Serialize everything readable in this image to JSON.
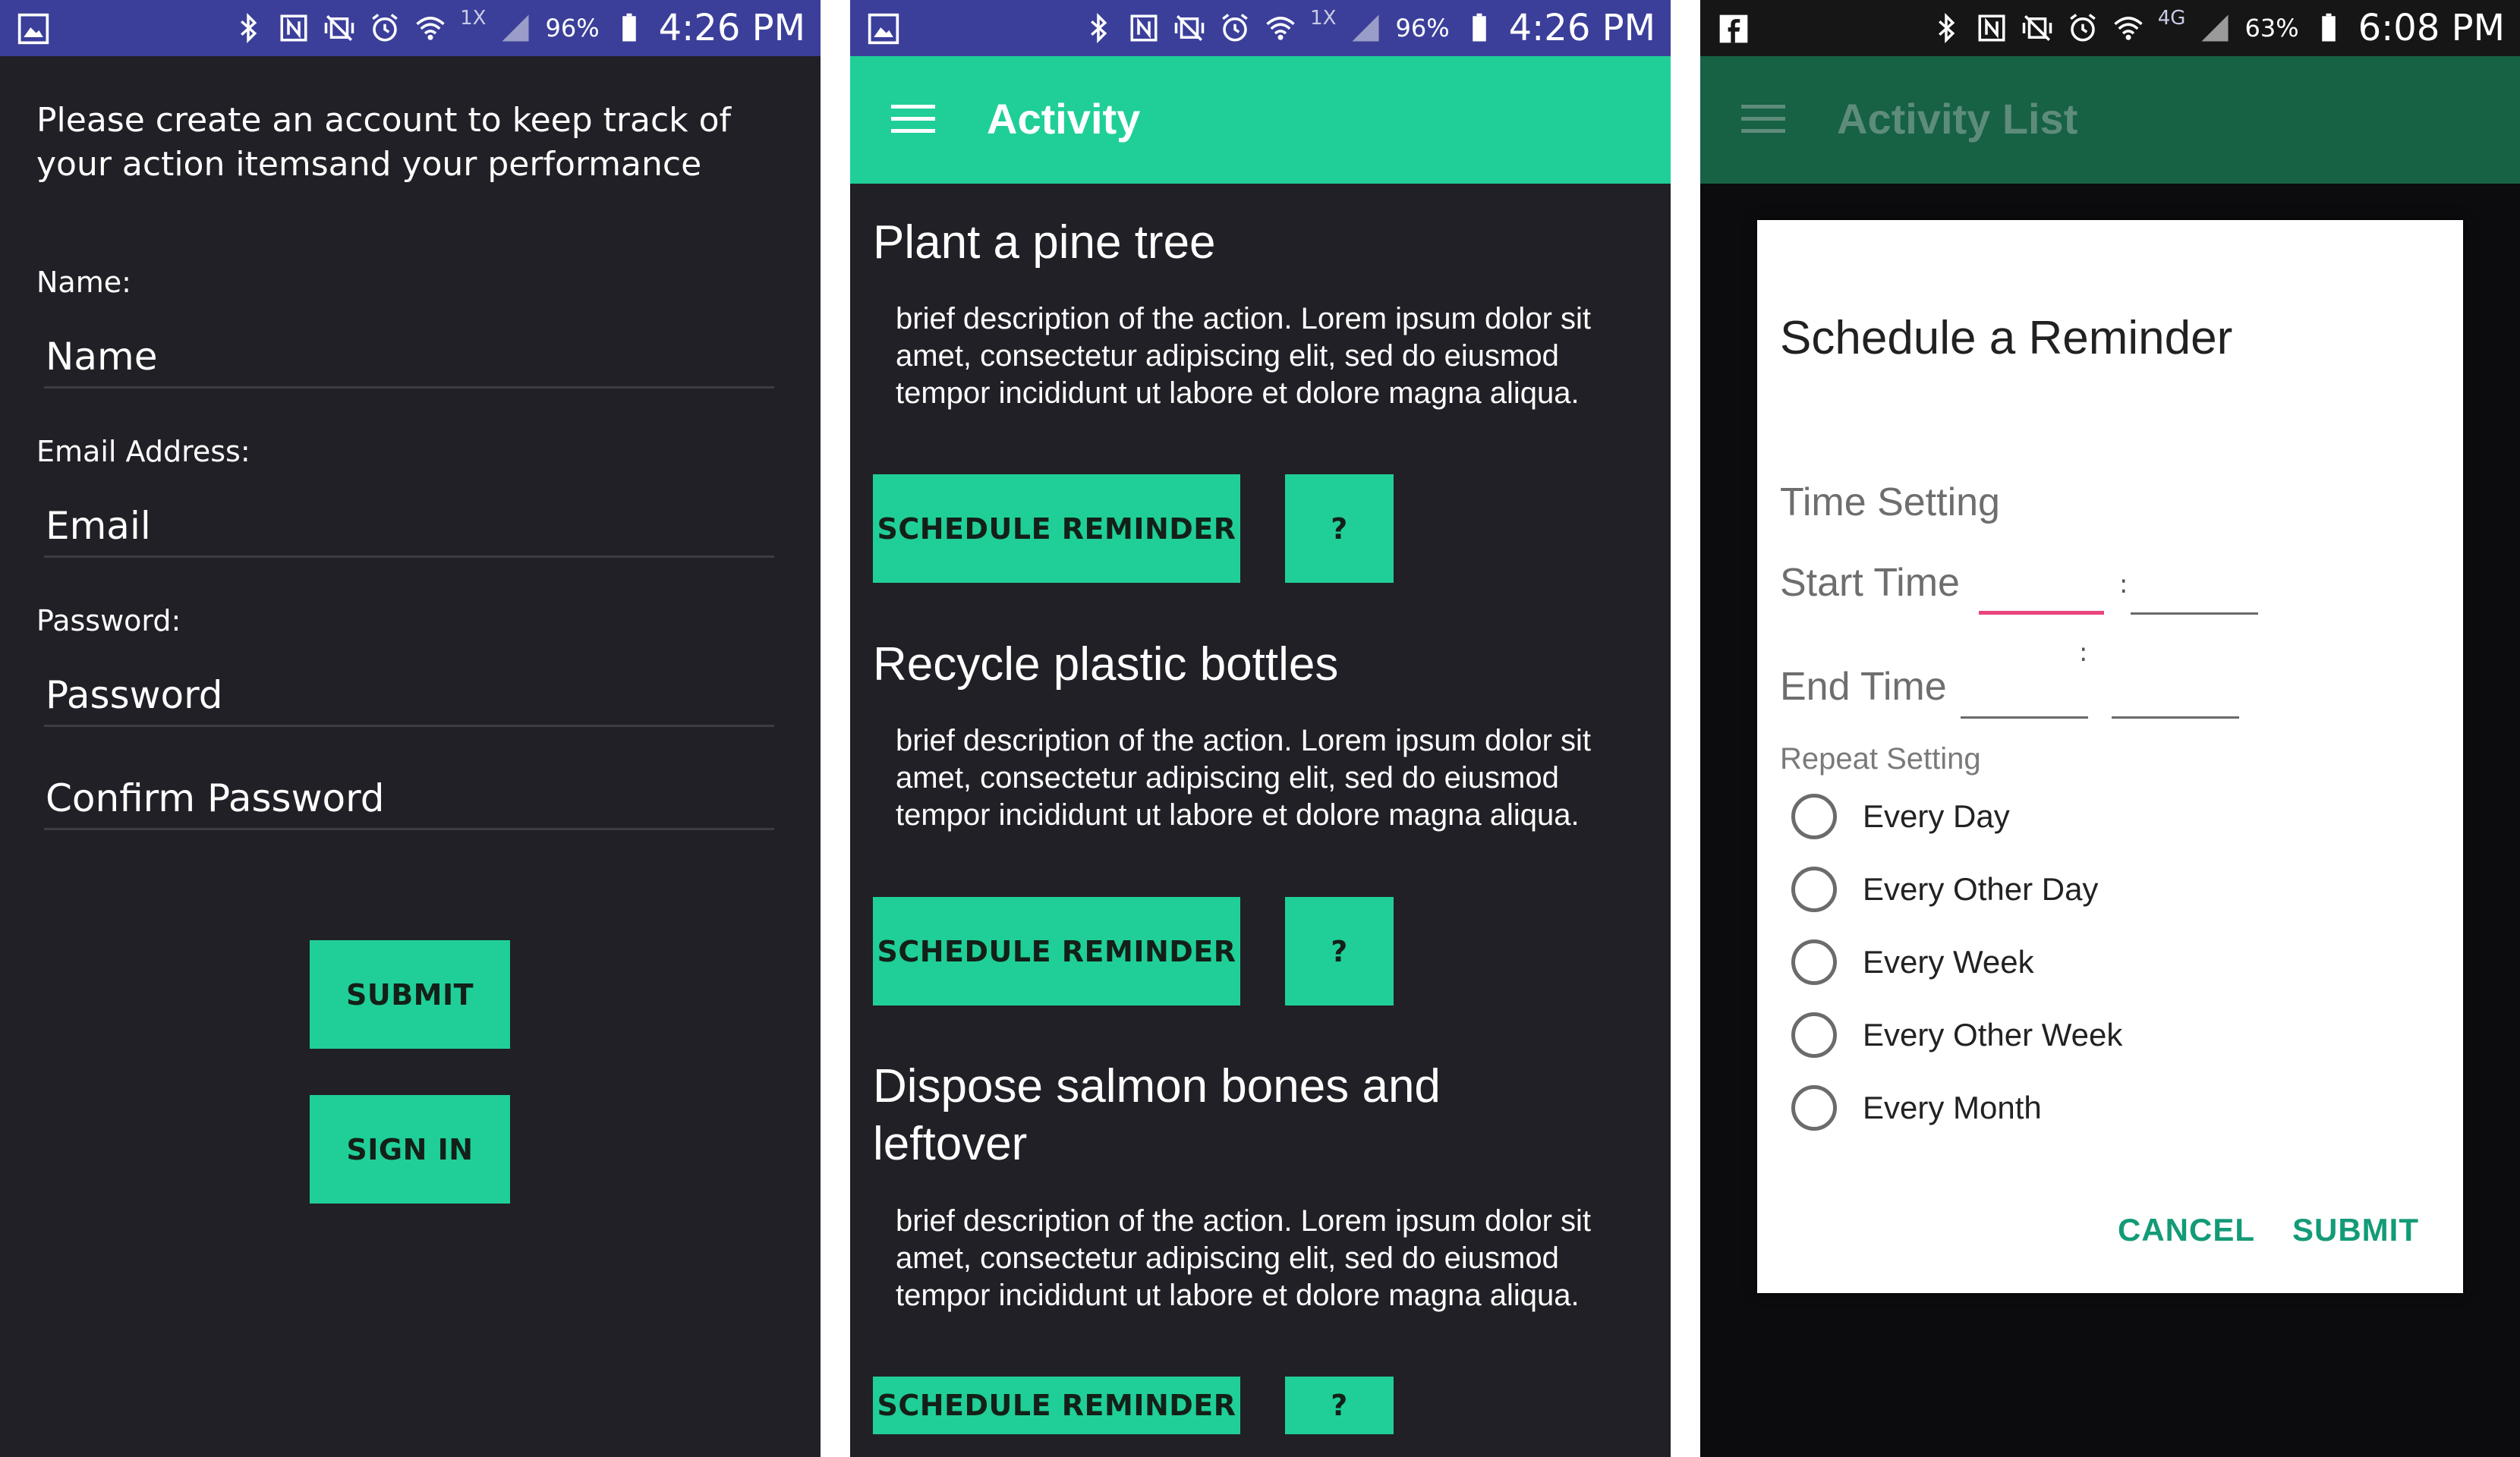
{
  "statusbar": {
    "phone1": {
      "left_icon": "gallery-icon",
      "small": "1X",
      "battery": "96%",
      "time": "4:26 PM"
    },
    "phone2": {
      "left_icon": "gallery-icon",
      "small": "1X",
      "battery": "96%",
      "time": "4:26 PM"
    },
    "phone3": {
      "left_icon": "facebook-icon",
      "small": "4G",
      "battery": "63%",
      "time": "6:08 PM"
    }
  },
  "signup": {
    "intro": "Please create an account to keep track of your action itemsand your performance",
    "name_label": "Name:",
    "name_placeholder": "Name",
    "email_label": "Email Address:",
    "email_placeholder": "Email",
    "password_label": "Password:",
    "password_placeholder": "Password",
    "confirm_placeholder": "Confirm Password",
    "submit": "SUBMIT",
    "signin": "SIGN IN"
  },
  "activity": {
    "title": "Activity",
    "items": [
      {
        "title": "Plant a pine tree",
        "description": "brief description of the action. Lorem ipsum dolor sit amet, consectetur adipiscing elit, sed do eiusmod tempor incididunt ut labore et dolore magna aliqua.",
        "schedule": "SCHEDULE REMINDER",
        "help": "?"
      },
      {
        "title": "Recycle plastic bottles",
        "description": "brief description of the action. Lorem ipsum dolor sit amet, consectetur adipiscing elit, sed do eiusmod tempor incididunt ut labore et dolore magna aliqua.",
        "schedule": "SCHEDULE REMINDER",
        "help": "?"
      },
      {
        "title": "Dispose salmon bones and leftover",
        "description": "brief description of the action. Lorem ipsum dolor sit amet, consectetur adipiscing elit, sed do eiusmod tempor incididunt ut labore et dolore magna aliqua.",
        "schedule": "SCHEDULE REMINDER",
        "help": "?"
      }
    ]
  },
  "activity_list": {
    "title": "Activity List"
  },
  "reminder_dialog": {
    "title": "Schedule a Reminder",
    "time_setting": "Time Setting",
    "start_time": "Start Time",
    "end_time": "End Time",
    "repeat_setting": "Repeat Setting",
    "options": [
      "Every Day",
      "Every Other Day",
      "Every Week",
      "Every Other Week",
      "Every Month"
    ],
    "cancel": "CANCEL",
    "submit": "SUBMIT"
  },
  "colors": {
    "accent": "#20cf98",
    "statusbar": "#3b3f9a",
    "background": "#212026",
    "dialog_button": "#139b77",
    "field_focus": "#e8457d"
  }
}
